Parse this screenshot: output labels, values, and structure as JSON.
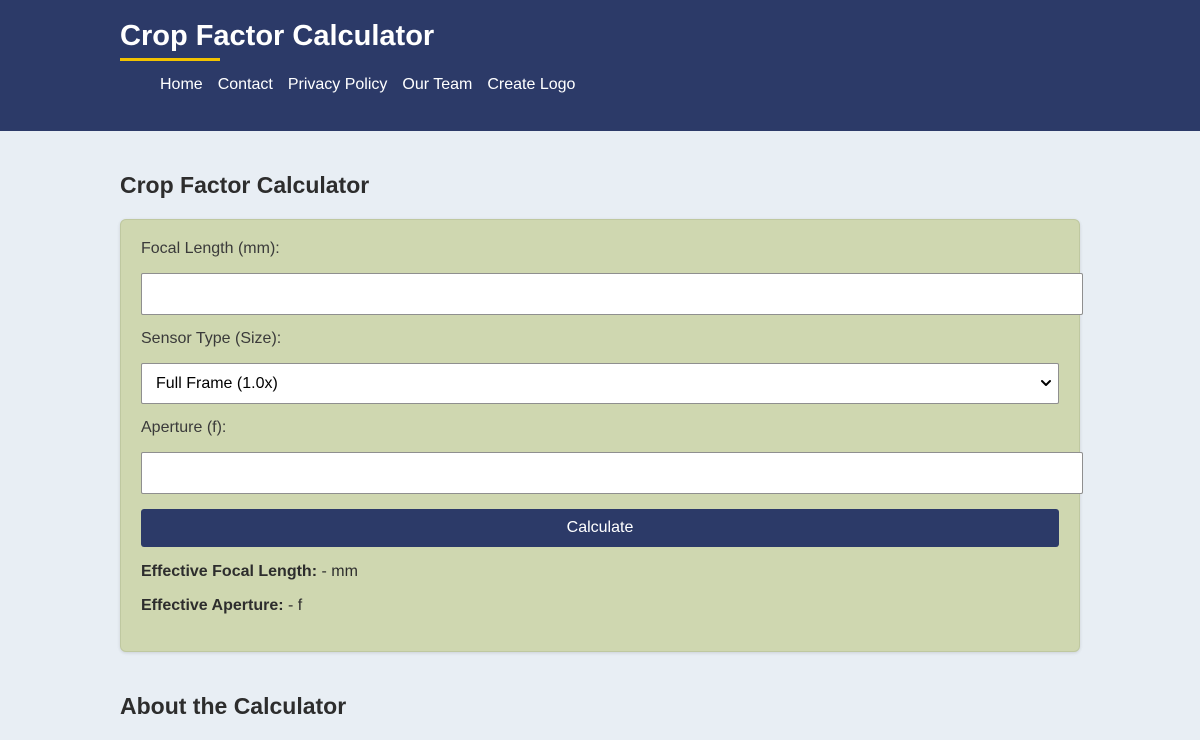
{
  "header": {
    "site_title": "Crop Factor Calculator",
    "accent_color": "#f2c200",
    "background_color": "#2c3a68",
    "nav": [
      "Home",
      "Contact",
      "Privacy Policy",
      "Our Team",
      "Create Logo"
    ]
  },
  "main": {
    "heading": "Crop Factor Calculator",
    "form": {
      "focal_length_label": "Focal Length (mm):",
      "focal_length_value": "",
      "sensor_label": "Sensor Type (Size):",
      "sensor_selected": "Full Frame (1.0x)",
      "aperture_label": "Aperture (f):",
      "aperture_value": "",
      "calculate_label": "Calculate"
    },
    "results": {
      "focal_label": "Effective Focal Length:",
      "focal_value": "- mm",
      "aperture_label": "Effective Aperture:",
      "aperture_value": "- f"
    },
    "about_heading": "About the Calculator"
  },
  "icons": {
    "select_arrow": "chevron-down-icon"
  }
}
